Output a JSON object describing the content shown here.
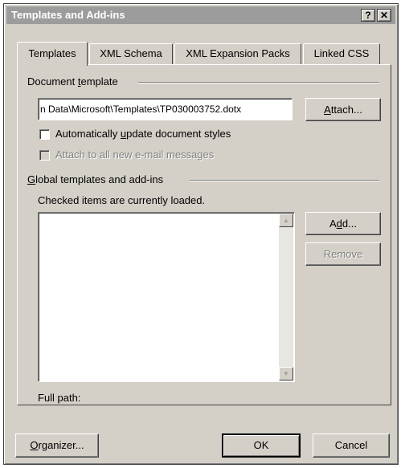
{
  "window": {
    "title": "Templates and Add-ins",
    "help_glyph": "?",
    "close_glyph": "✕"
  },
  "tabs": [
    {
      "label": "Templates",
      "active": true
    },
    {
      "label": "XML Schema",
      "active": false
    },
    {
      "label": "XML Expansion Packs",
      "active": false
    },
    {
      "label": "Linked CSS",
      "active": false
    }
  ],
  "document_template": {
    "section_label_pre": "Document ",
    "section_label_key": "t",
    "section_label_post": "emplate",
    "path_value": "n Data\\Microsoft\\Templates\\TP030003752.dotx",
    "attach_button_key": "A",
    "attach_button_rest": "ttach...",
    "auto_update_pre": "Automatically ",
    "auto_update_key": "u",
    "auto_update_post": "pdate document styles",
    "auto_update_checked": false,
    "attach_email_label": "Attach to all new e-mail messages",
    "attach_email_checked": false
  },
  "global_templates": {
    "section_label_key": "G",
    "section_label_rest": "lobal templates and add-ins",
    "note": "Checked items are currently loaded.",
    "items": [],
    "add_button_pre": "A",
    "add_button_key": "d",
    "add_button_post": "d...",
    "remove_button_label": "Remove",
    "full_path_label": "Full path:"
  },
  "footer": {
    "organizer_key": "O",
    "organizer_rest": "rganizer...",
    "ok_label": "OK",
    "cancel_label": "Cancel"
  },
  "icons": {
    "scroll_up": "▲",
    "scroll_down": "▼"
  },
  "colors": {
    "dialog_face": "#d4d0c8",
    "titlebar_inactive": "#9c9c9c",
    "disabled_text": "#808080"
  }
}
